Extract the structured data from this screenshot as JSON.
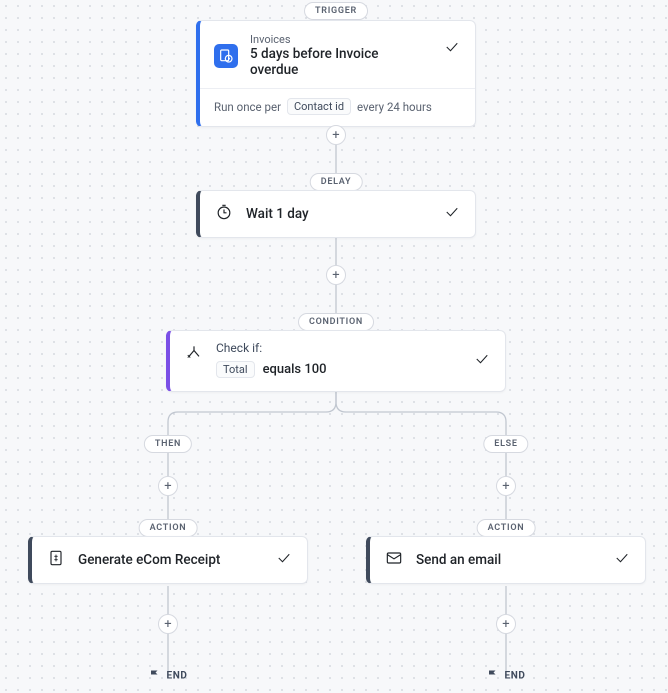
{
  "labels": {
    "trigger": "TRIGGER",
    "delay": "DELAY",
    "condition": "CONDITION",
    "then": "THEN",
    "else": "ELSE",
    "action": "ACTION",
    "end": "END"
  },
  "trigger": {
    "category": "Invoices",
    "title": "5 days before Invoice overdue",
    "run_prefix": "Run once per",
    "run_tag": "Contact id",
    "run_suffix": "every 24 hours"
  },
  "delay": {
    "label": "Wait 1 day"
  },
  "condition": {
    "check_label": "Check if:",
    "field_tag": "Total",
    "operator_value": "equals 100"
  },
  "then_action": {
    "label": "Generate eCom Receipt"
  },
  "else_action": {
    "label": "Send an email"
  },
  "icons": {
    "plus": "+"
  }
}
